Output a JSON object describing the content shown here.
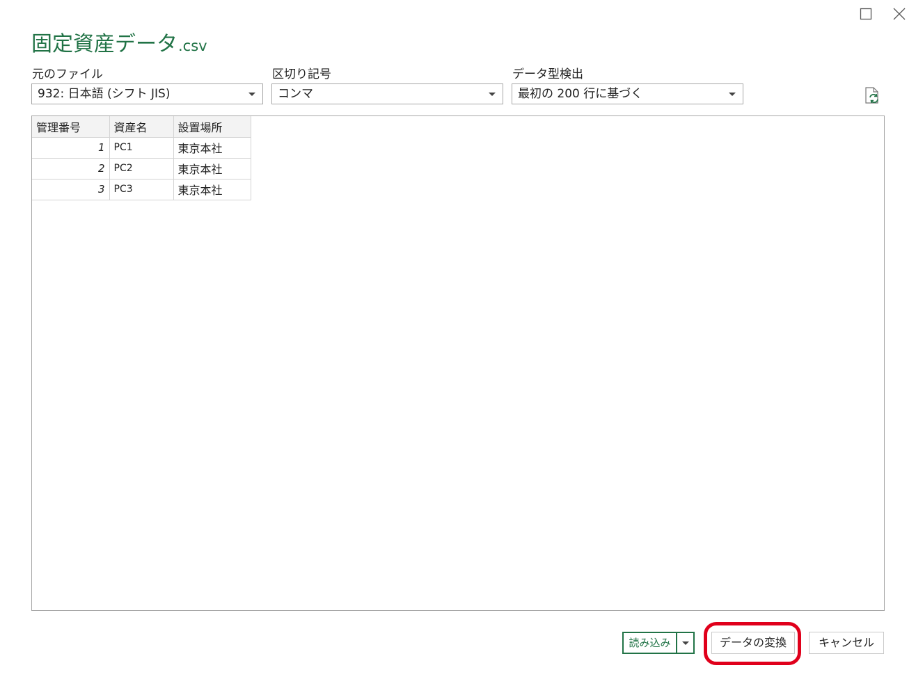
{
  "window": {
    "title_main": "固定資産データ",
    "title_ext": ".csv"
  },
  "options": {
    "file_origin": {
      "label": "元のファイル",
      "value": "932: 日本語 (シフト JIS)"
    },
    "delimiter": {
      "label": "区切り記号",
      "value": "コンマ"
    },
    "data_type_detection": {
      "label": "データ型検出",
      "value": "最初の 200 行に基づく"
    }
  },
  "preview": {
    "columns": [
      "管理番号",
      "資産名",
      "設置場所"
    ],
    "rows": [
      [
        "1",
        "PC1",
        "東京本社"
      ],
      [
        "2",
        "PC2",
        "東京本社"
      ],
      [
        "3",
        "PC3",
        "東京本社"
      ]
    ]
  },
  "footer": {
    "load_label": "読み込み",
    "transform_label": "データの変換",
    "cancel_label": "キャンセル"
  },
  "colors": {
    "accent": "#217346",
    "highlight": "#e0001b"
  },
  "icons": {
    "maximize": "maximize-icon",
    "close": "close-icon",
    "refresh": "refresh-icon",
    "dropdown": "chevron-down-icon"
  }
}
